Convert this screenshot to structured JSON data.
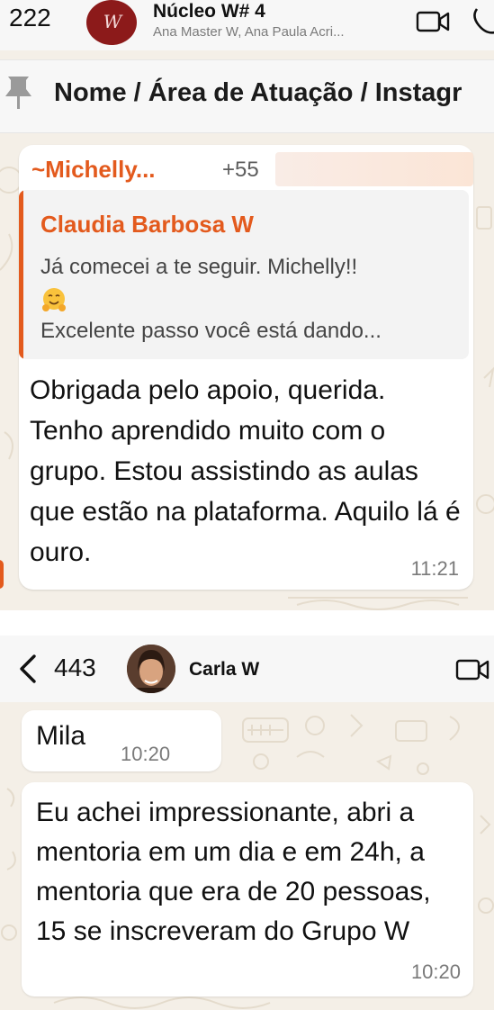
{
  "screenshot_1": {
    "header": {
      "unread_count": "222",
      "avatar_text": "W",
      "group_name": "Núcleo W# 4",
      "members": "Ana Master W, Ana Paula Acri..."
    },
    "pinned": {
      "text": "Nome / Área de Atuação / Instagr"
    },
    "message": {
      "sender_name": "~Michelly...",
      "sender_phone": "+55",
      "quoted": {
        "author": "Claudia Barbosa W",
        "line1": "Já comecei a te seguir. Michelly!!",
        "emoji": "hugging-face",
        "line2": "Excelente passo você está dando..."
      },
      "text": "Obrigada pelo apoio, querida. Tenho aprendido muito com o grupo. Estou assistindo as aulas que estão na plataforma. Aquilo lá é ouro.",
      "time": "11:21"
    }
  },
  "screenshot_2": {
    "header": {
      "unread_count": "443",
      "contact_name": "Carla W"
    },
    "messages": [
      {
        "text": "Mila",
        "time": "10:20"
      },
      {
        "text": "Eu achei impressionante, abri a mentoria em um dia e em 24h, a mentoria que era de 20 pessoas, 15 se inscreveram do Grupo W",
        "time": "10:20"
      }
    ]
  },
  "colors": {
    "accent_orange": "#e35a1d",
    "chat_background": "#f4efe7",
    "avatar_red": "#8c1a1a",
    "bubble": "#ffffff"
  }
}
